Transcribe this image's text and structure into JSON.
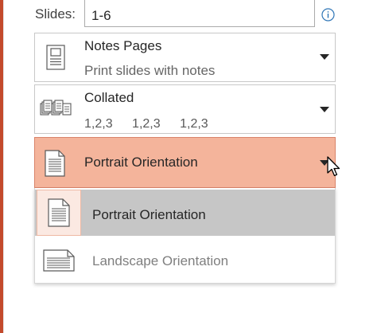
{
  "slides": {
    "label": "Slides:",
    "value": "1-6"
  },
  "icons": {
    "info": "info-icon",
    "notes_page": "notes-page-icon",
    "collated": "collated-icon",
    "portrait": "portrait-page-icon",
    "landscape": "landscape-page-icon",
    "caret": "chevron-down-icon",
    "cursor": "mouse-pointer-icon"
  },
  "layout_dropdown": {
    "title": "Notes Pages",
    "subtitle": "Print slides with notes"
  },
  "collation_dropdown": {
    "title": "Collated",
    "sequence": [
      "1,2,3",
      "1,2,3",
      "1,2,3"
    ]
  },
  "orientation_dropdown": {
    "selected": "Portrait Orientation",
    "options": [
      {
        "label": "Portrait Orientation",
        "selected": true
      },
      {
        "label": "Landscape Orientation",
        "selected": false
      }
    ]
  },
  "colors": {
    "accent": "#c34a2c",
    "open_dropdown_bg": "#f4b49b",
    "selected_item_bg": "#c6c6c6",
    "info_icon": "#2e75b6"
  }
}
